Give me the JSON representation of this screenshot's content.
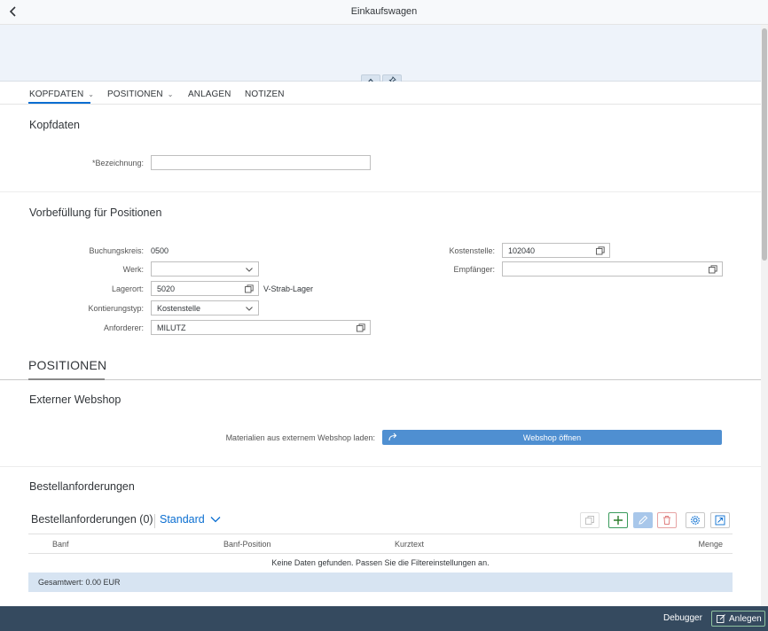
{
  "app": {
    "title": "Einkaufswagen"
  },
  "tabs": [
    {
      "label": "KOPFDATEN",
      "has_dropdown": true,
      "active": true
    },
    {
      "label": "POSITIONEN",
      "has_dropdown": true
    },
    {
      "label": "ANLAGEN",
      "has_dropdown": false
    },
    {
      "label": "NOTIZEN",
      "has_dropdown": false
    }
  ],
  "kopfdaten": {
    "section_title": "Kopfdaten",
    "bezeichnung_label": "*Bezeichnung:",
    "bezeichnung_value": ""
  },
  "vorbefuellung": {
    "section_title": "Vorbefüllung für Positionen",
    "buchungskreis_label": "Buchungskreis:",
    "buchungskreis_value": "0500",
    "werk_label": "Werk:",
    "werk_value": "",
    "lagerort_label": "Lagerort:",
    "lagerort_value": "5020",
    "lagerort_desc": "V-Strab-Lager",
    "kontierungstyp_label": "Kontierungstyp:",
    "kontierungstyp_value": "Kostenstelle",
    "anforderer_label": "Anforderer:",
    "anforderer_value": "MILUTZ",
    "kostenstelle_label": "Kostenstelle:",
    "kostenstelle_value": "102040",
    "empfaenger_label": "Empfänger:",
    "empfaenger_value": ""
  },
  "positionen": {
    "heading": "POSITIONEN",
    "webshop_title": "Externer Webshop",
    "webshop_label": "Materialien aus externem Webshop laden:",
    "webshop_button": "Webshop öffnen",
    "banf_section_title": "Bestellanforderungen",
    "table_title": "Bestellanforderungen (0)",
    "variant": "Standard",
    "columns": [
      "Banf",
      "Banf-Position",
      "Kurztext",
      "Menge"
    ],
    "no_data": "Keine Daten gefunden. Passen Sie die Filtereinstellungen an.",
    "total": "Gesamtwert: 0.00 EUR"
  },
  "footer": {
    "debugger_label": "Debugger",
    "anlegen_label": "Anlegen"
  },
  "colors": {
    "accent": "#0a6ed1",
    "shell_footer": "#354a5f",
    "webshop_button": "#4f8fd1",
    "total_bar": "#d7e4f2"
  }
}
